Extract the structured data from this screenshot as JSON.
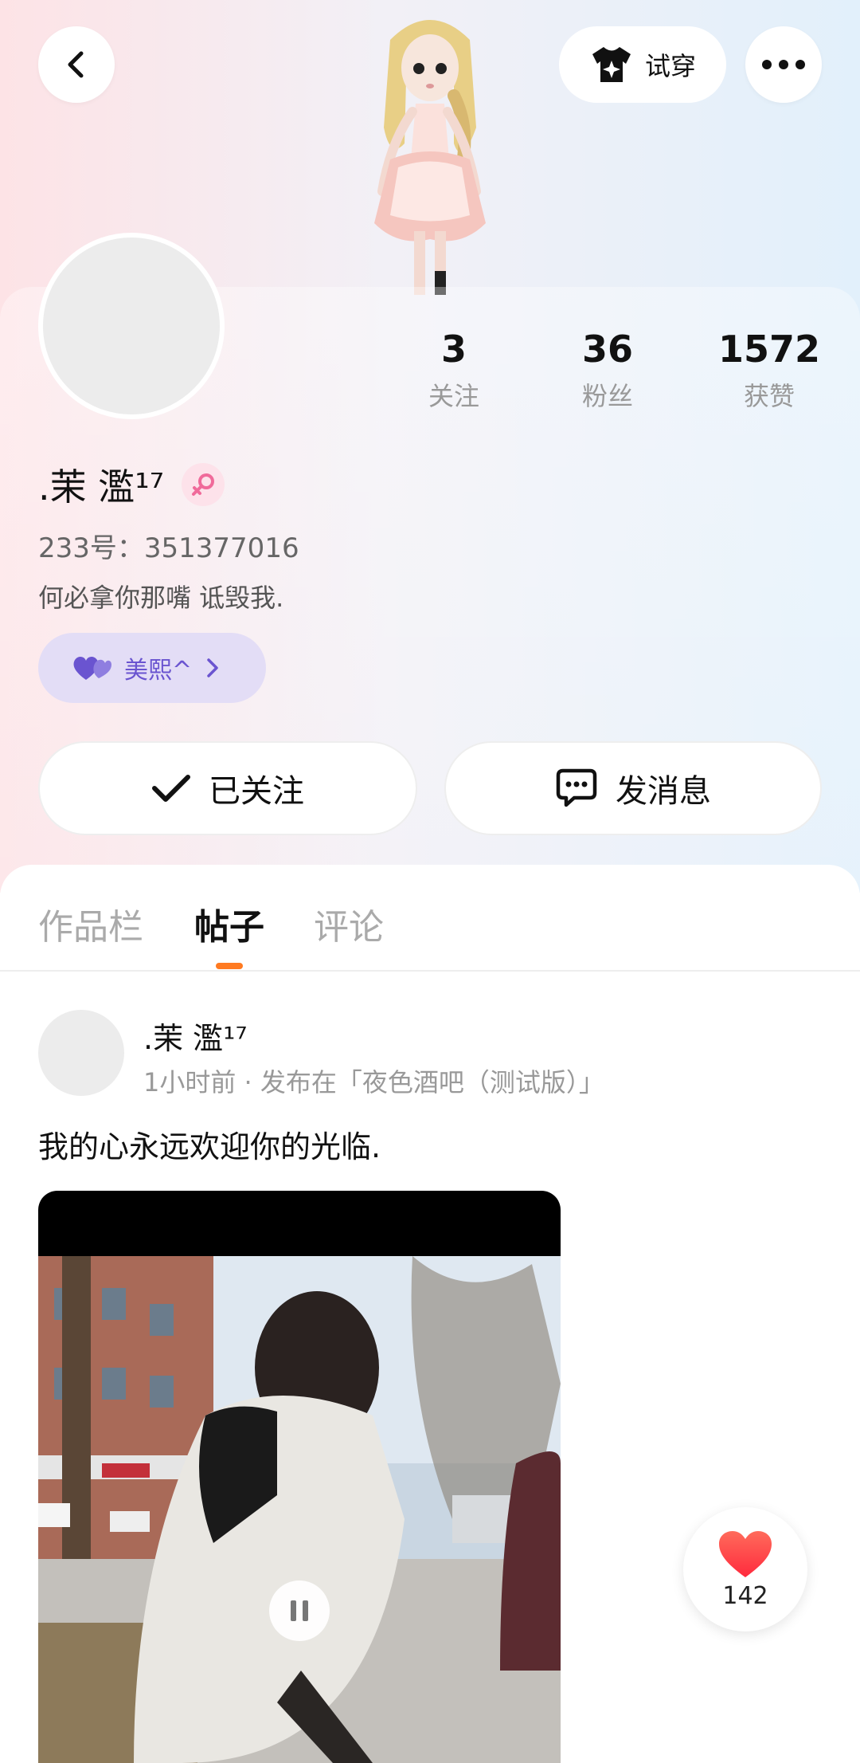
{
  "header": {
    "back_icon": "chevron-left-icon",
    "tryon_label": "试穿",
    "tryon_icon": "tshirt-sparkle-icon",
    "more_icon": "more-horizontal-icon"
  },
  "profile": {
    "name": ".茉 濫¹⁷",
    "gender_icon": "female-icon",
    "uid": "233号：351377016",
    "bio": "何必拿你那嘴 诋毁我.",
    "tag_label": "美熙^",
    "tag_icon": "double-heart-icon",
    "stats": [
      {
        "value": "3",
        "label": "关注"
      },
      {
        "value": "36",
        "label": "粉丝"
      },
      {
        "value": "1572",
        "label": "获赞"
      }
    ]
  },
  "actions": {
    "follow_label": "已关注",
    "follow_icon": "check-icon",
    "message_label": "发消息",
    "message_icon": "chat-bubble-icon"
  },
  "tabs": [
    {
      "label": "作品栏",
      "active": false
    },
    {
      "label": "帖子",
      "active": true
    },
    {
      "label": "评论",
      "active": false
    }
  ],
  "post": {
    "author": ".茉 濫¹⁷",
    "meta": "1小时前 · 发布在「夜色酒吧（测试版）」",
    "text": "我的心永远欢迎你的光临.",
    "like_count": "142",
    "video_state": "playing"
  },
  "colors": {
    "accent_orange": "#ff7a21",
    "tag_bg": "#e3ddf6",
    "tag_text": "#6a54d0",
    "like_red": "#ff3b3b"
  }
}
